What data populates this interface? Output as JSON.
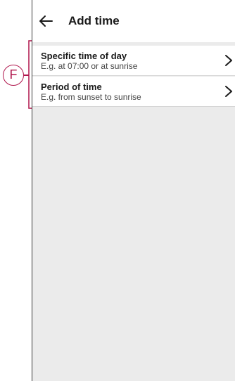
{
  "header": {
    "title": "Add time",
    "back_icon": "arrow-left-icon"
  },
  "options": [
    {
      "title": "Specific time of day",
      "subtitle": "E.g. at 07:00 or at sunrise",
      "icon": "chevron-right-icon"
    },
    {
      "title": "Period of time",
      "subtitle": "E.g. from sunset to sunrise",
      "icon": "chevron-right-icon"
    }
  ],
  "annotation": {
    "label": "F",
    "color": "#b0174d"
  }
}
